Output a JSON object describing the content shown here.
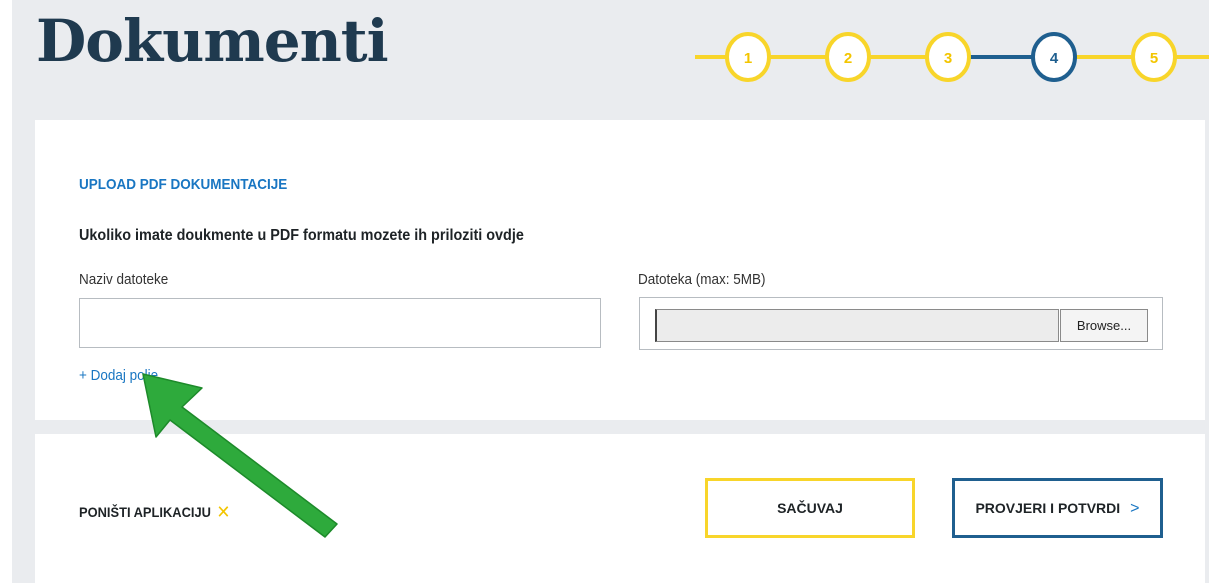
{
  "page": {
    "title": "Dokumenti"
  },
  "stepper": {
    "steps": [
      "1",
      "2",
      "3",
      "4",
      "5"
    ],
    "active_index": 3,
    "colors": {
      "done": "#f8d52a",
      "active": "#1f5f8f"
    }
  },
  "upload": {
    "section_title": "UPLOAD PDF DOKUMENTACIJE",
    "subtitle": "Ukoliko imate doukmente u PDF formatu mozete ih priloziti ovdje",
    "name_label": "Naziv datoteke",
    "name_value": "",
    "file_label": "Datoteka (max: 5MB)",
    "file_value": "",
    "browse_label": "Browse...",
    "add_field_label": "+ Dodaj polje"
  },
  "actions": {
    "cancel_label": "PONIŠTI APLIKACIJU",
    "cancel_icon": "close-icon",
    "save_label": "SAČUVAJ",
    "confirm_label": "PROVJERI I POTVRDI",
    "confirm_icon": "chevron-right-icon"
  },
  "annotation": {
    "arrow_color": "#2eaa3c"
  },
  "colors": {
    "accent_blue": "#1976c2",
    "accent_yellow": "#f8d52a",
    "dark_blue": "#1f5f8f",
    "title": "#1f3a4f",
    "page_bg": "#eaecef"
  }
}
